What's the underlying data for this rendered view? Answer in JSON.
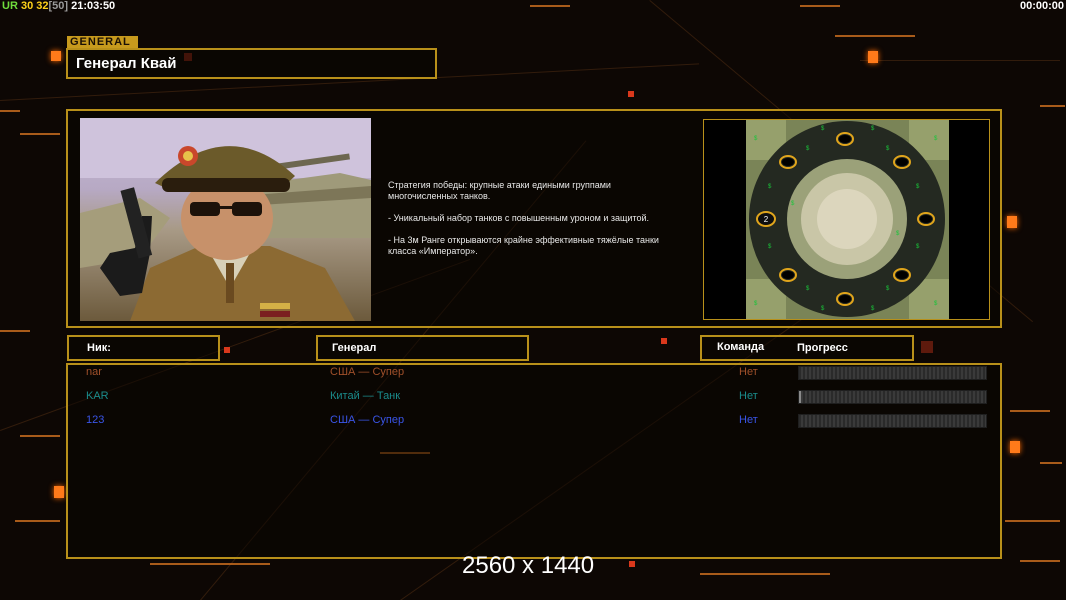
{
  "status_bar": {
    "ur_label": "UR",
    "v1": "30",
    "v2": "32",
    "v3": "[50]",
    "clock": "21:03:50",
    "timer": "00:00:00"
  },
  "general": {
    "tag": "GENERAL",
    "name": "Генерал Квай",
    "description": "Стратегия победы: крупные атаки едиными группами\n многочисленных танков.\n\n- Уникальный набор танков с повышенным уроном и защитой.\n\n- На 3м Ранге открываются крайне эффективные тяжёлые танки\n класса «Император».",
    "map_start_label": "2"
  },
  "table": {
    "headers": {
      "nick": "Ник:",
      "general": "Генерал",
      "team": "Команда",
      "progress": "Прогресс"
    },
    "players": [
      {
        "nick": "nar",
        "general": "США — Супер",
        "team": "Нет",
        "progress": 0.0,
        "color": "#a0502a"
      },
      {
        "nick": "KAR",
        "general": "Китай — Танк",
        "team": "Нет",
        "progress": 0.01,
        "color": "#1a8c8c"
      },
      {
        "nick": "123",
        "general": "США — Супер",
        "team": "Нет",
        "progress": 0.0,
        "color": "#3a55e8"
      }
    ]
  },
  "resolution_label": "2560 x 1440",
  "colors": {
    "frame": "#b8901a",
    "tag_bg": "#c79a1d",
    "ur": "#6fdc3c",
    "v1": "#ffd21a",
    "v2": "#ffd21a",
    "v3": "#9a9a9a"
  }
}
